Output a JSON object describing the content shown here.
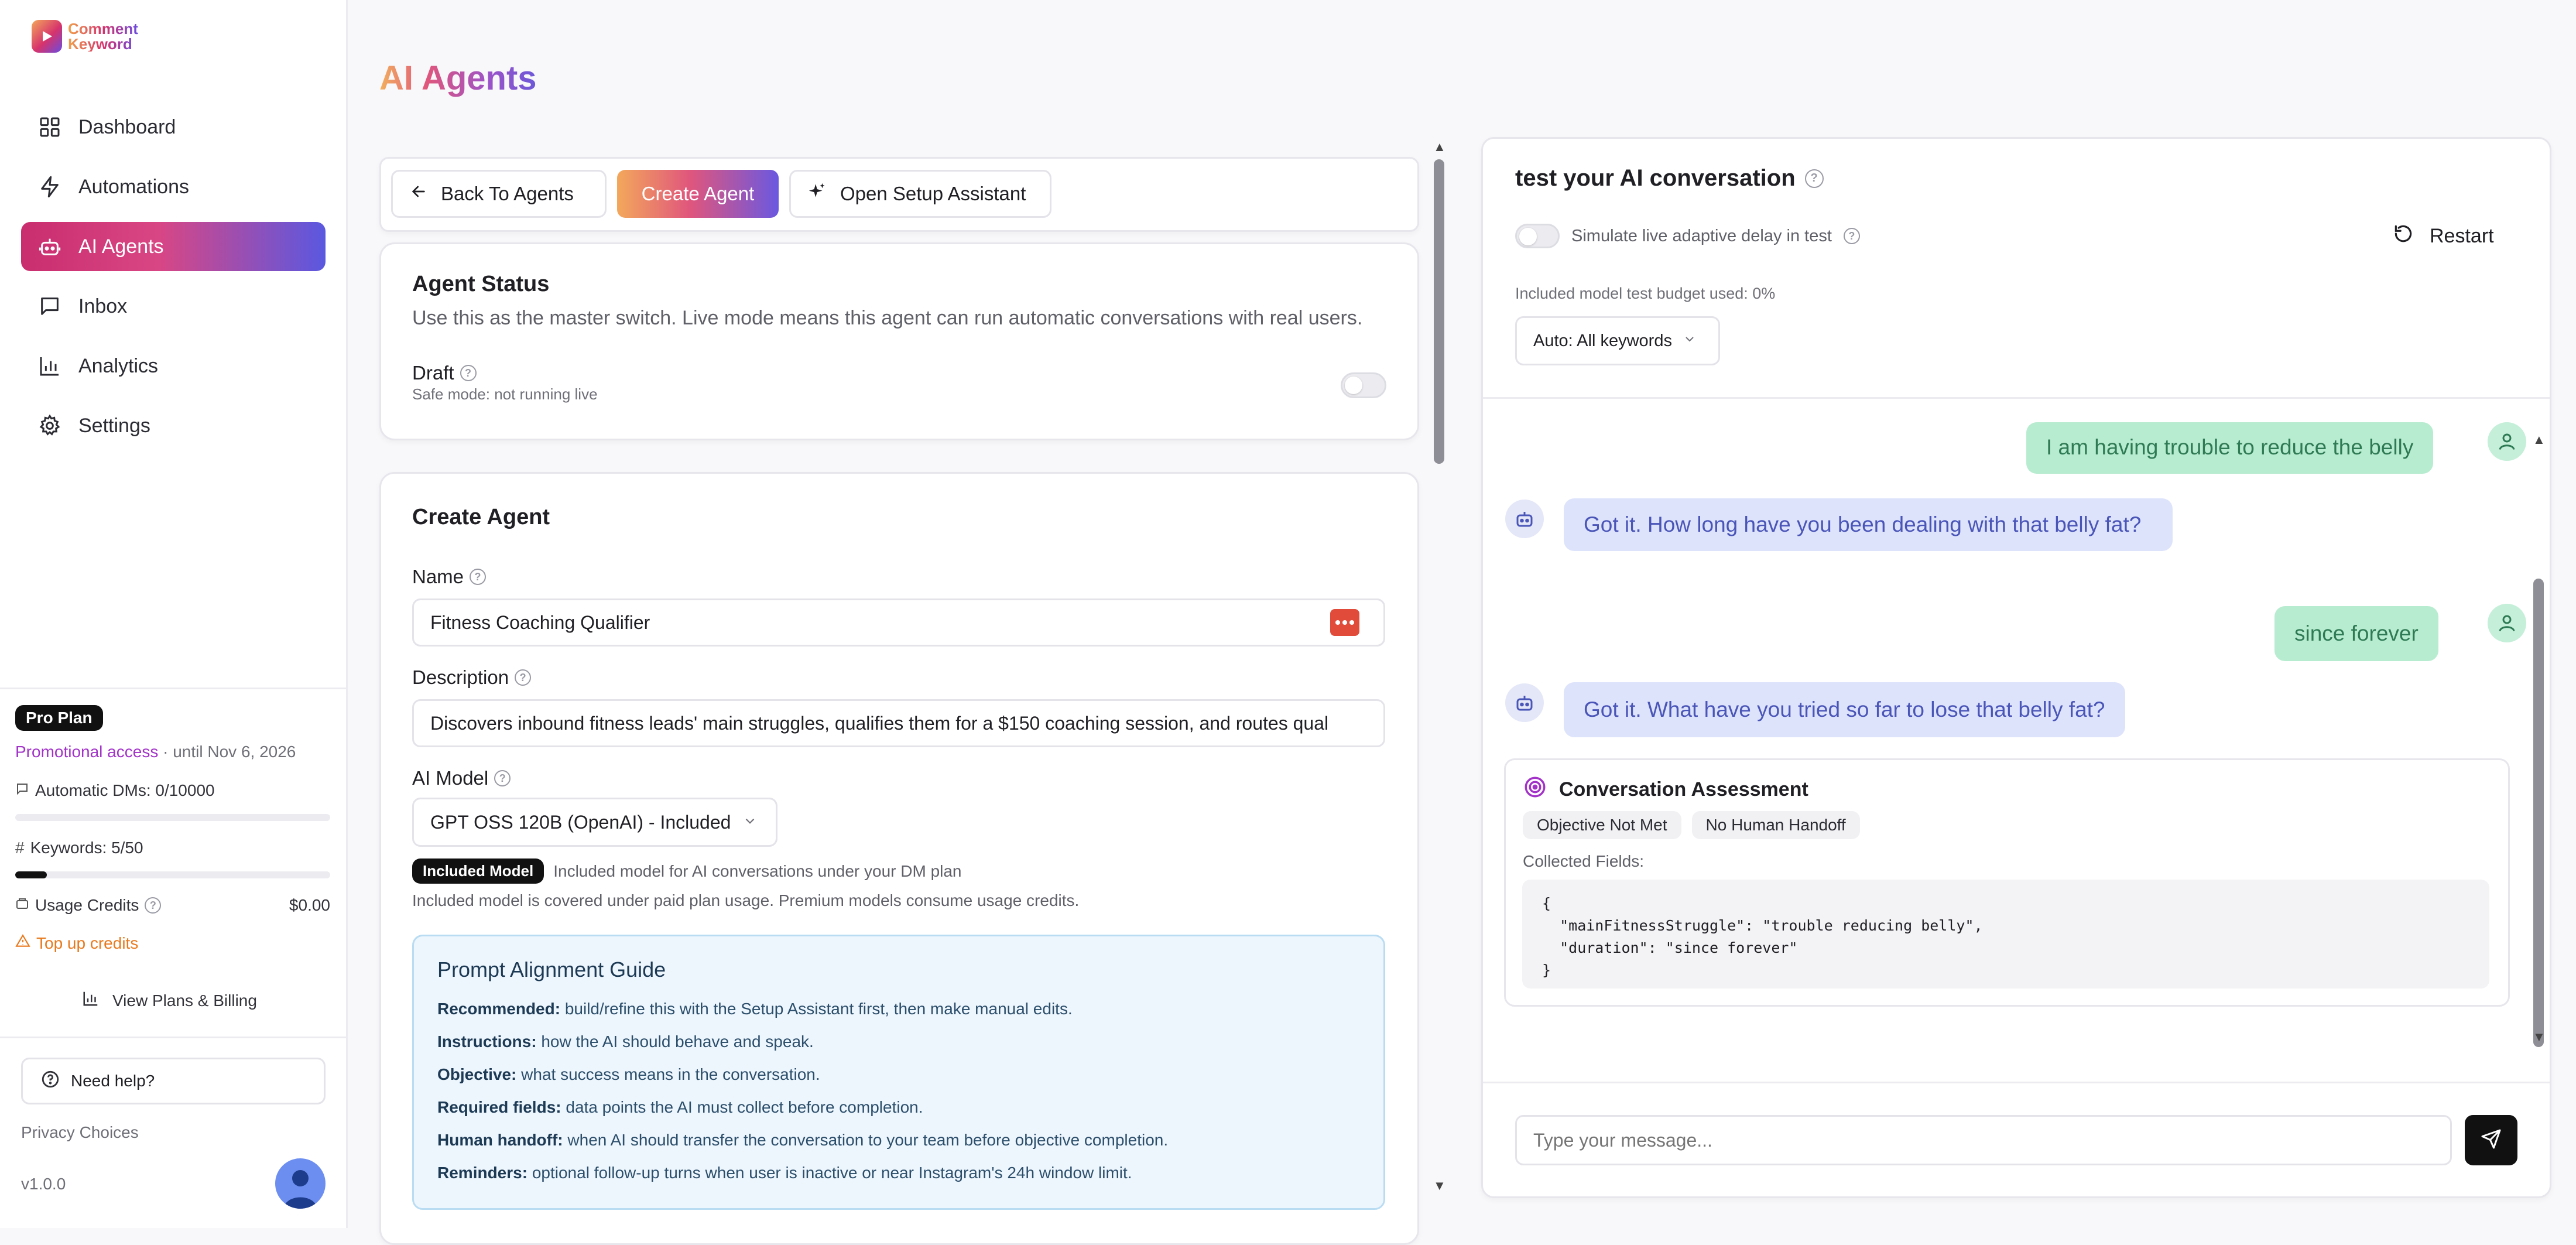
{
  "brand": {
    "line1": "Comment",
    "line2": "Keyword"
  },
  "sidebar": {
    "items": [
      {
        "label": "Dashboard",
        "icon": "grid-icon"
      },
      {
        "label": "Automations",
        "icon": "bolt-icon"
      },
      {
        "label": "AI Agents",
        "icon": "robot-icon"
      },
      {
        "label": "Inbox",
        "icon": "message-square-icon"
      },
      {
        "label": "Analytics",
        "icon": "bar-chart-icon"
      },
      {
        "label": "Settings",
        "icon": "gear-icon"
      }
    ],
    "active_index": 2,
    "plan": {
      "badge": "Pro Plan",
      "promo": "Promotional access",
      "promo_until": "· until Nov 6, 2026",
      "dms_label": "Automatic DMs: 0/10000",
      "dms_progress": 0.0,
      "keywords_label": "Keywords: 5/50",
      "keywords_progress": 0.1,
      "credits_label": "Usage Credits",
      "credits_value": "$0.00",
      "topup": "Top up credits",
      "billing": "View Plans & Billing"
    },
    "help": "Need help?",
    "privacy": "Privacy Choices",
    "version": "v1.0.0"
  },
  "page": {
    "title_part1": "AI",
    "title_part2": " Agents"
  },
  "toolbar": {
    "back": "Back To Agents",
    "create": "Create Agent",
    "assistant": "Open Setup Assistant"
  },
  "status_card": {
    "title": "Agent Status",
    "description": "Use this as the master switch. Live mode means this agent can run automatic conversations with real users.",
    "state": "Draft",
    "state_hint": "Safe mode: not running live"
  },
  "create_card": {
    "title": "Create Agent",
    "name_label": "Name",
    "name_value": "Fitness Coaching Qualifier",
    "description_label": "Description",
    "description_value": "Discovers inbound fitness leads' main struggles, qualifies them for a $150 coaching session, and routes qual",
    "model_label": "AI Model",
    "model_value": "GPT OSS 120B (OpenAI) - Included",
    "model_badge": "Included Model",
    "model_badge_text": "Included model for AI conversations under your DM plan",
    "model_note": "Included model is covered under paid plan usage. Premium models consume usage credits."
  },
  "guide": {
    "title": "Prompt Alignment Guide",
    "rows": [
      {
        "key": "Recommended:",
        "text": " build/refine this with the Setup Assistant first, then make manual edits."
      },
      {
        "key": "Instructions:",
        "text": " how the AI should behave and speak."
      },
      {
        "key": "Objective:",
        "text": " what success means in the conversation."
      },
      {
        "key": "Required fields:",
        "text": " data points the AI must collect before completion."
      },
      {
        "key": "Human handoff:",
        "text": " when AI should transfer the conversation to your team before objective completion."
      },
      {
        "key": "Reminders:",
        "text": " optional follow-up turns when user is inactive or near Instagram's 24h window limit."
      }
    ]
  },
  "chat": {
    "title": "test your AI conversation",
    "simulate": "Simulate live adaptive delay in test",
    "restart": "Restart",
    "budget": "Included model test budget used: 0%",
    "keyword_select": "Auto: All keywords",
    "messages": [
      {
        "role": "user",
        "text": "I am having trouble to reduce the belly"
      },
      {
        "role": "bot",
        "text": "Got it. How long have you been dealing with that belly fat?"
      },
      {
        "role": "user",
        "text": "since forever"
      },
      {
        "role": "bot",
        "text": "Got it. What have you tried so far to lose that belly fat?"
      }
    ],
    "assessment": {
      "title": "Conversation Assessment",
      "pills": [
        "Objective Not Met",
        "No Human Handoff"
      ],
      "collected_label": "Collected Fields:",
      "json": "{\n  \"mainFitnessStruggle\": \"trouble reducing belly\",\n  \"duration\": \"since forever\"\n}"
    },
    "input_placeholder": "Type your message..."
  },
  "colors": {
    "accent_pink": "#d6336c",
    "accent_purple": "#5a58e0",
    "accent_orange": "#f3a85b",
    "user_bubble": "#b8ecd0",
    "bot_bubble": "#dde3fb"
  }
}
